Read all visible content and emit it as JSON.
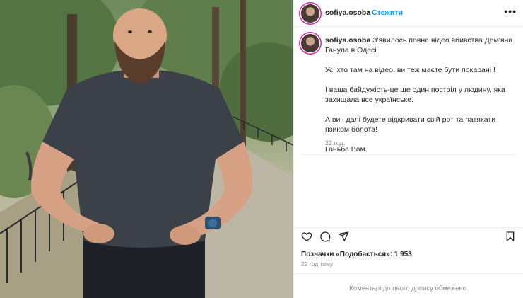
{
  "header": {
    "username": "sofiya.osoba",
    "separator": "•",
    "follow_label": "Стежити",
    "more_label": "•••"
  },
  "caption": {
    "username": "sofiya.osoba",
    "paragraphs": [
      "З'явилось повне відео вбивства Дем'яна Ганула в Одесі.",
      "Усі хто там на відео, ви теж маєте бути покарані !",
      "І ваша байдужість-це ще один постріл у людину, яка захищала все українське.",
      "А ви і далі будете відкривати свій рот та патякати язиком болота!",
      "Ганьба Вам."
    ],
    "time": "22 год."
  },
  "actions": {
    "like_icon": "heart-icon",
    "comment_icon": "comment-icon",
    "share_icon": "paper-plane-icon",
    "save_icon": "bookmark-icon"
  },
  "likes": {
    "text": "Позначки «Подобається»: 1 953",
    "time": "22 год тому"
  },
  "comments_limited": "Коментарі до цього допису обмежено.",
  "colors": {
    "link_blue": "#0095f6",
    "text": "#262626",
    "muted": "#8e8e8e"
  }
}
